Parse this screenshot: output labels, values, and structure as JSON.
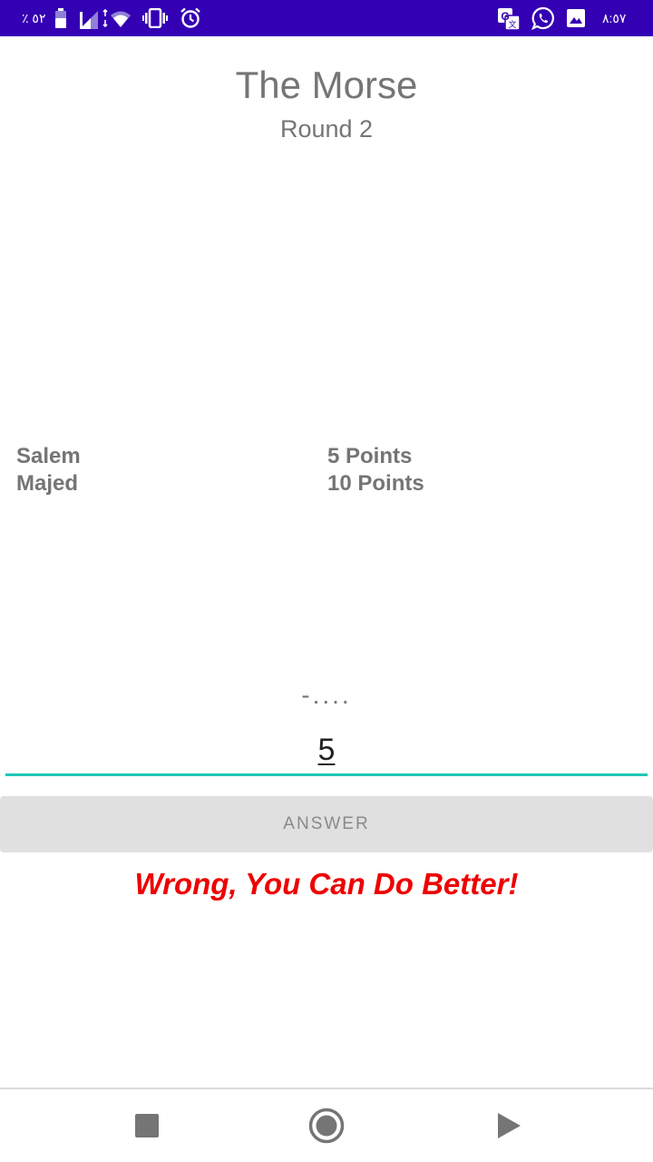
{
  "status_bar": {
    "battery_text": "٪ ٥٢",
    "time": "٨:٥٧",
    "icons": [
      "battery-icon",
      "signal-icon",
      "wifi-icon",
      "vibrate-icon",
      "alarm-icon",
      "translate-icon",
      "whatsapp-icon",
      "gallery-icon"
    ],
    "color": "#3400b3"
  },
  "header": {
    "title": "The Morse",
    "round": "Round 2"
  },
  "scores": [
    {
      "player": "Salem",
      "points": "5 Points"
    },
    {
      "player": "Majed",
      "points": "10 Points"
    }
  ],
  "question": {
    "morse_code": "-...."
  },
  "answer": {
    "value": "5",
    "button_label": "ANSWER"
  },
  "feedback": {
    "message": "Wrong, You Can Do Better!",
    "color": "#ee0000"
  },
  "nav_bar": {
    "icons": [
      "stop-icon",
      "record-icon",
      "play-icon"
    ]
  }
}
